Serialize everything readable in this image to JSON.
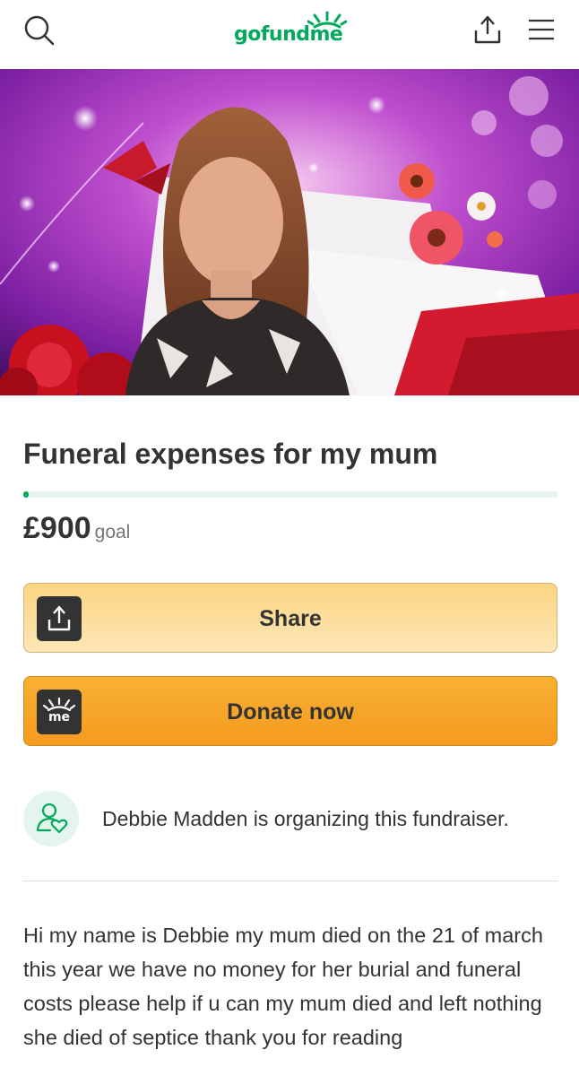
{
  "header": {
    "logo_text": "gofundme",
    "icons": [
      "search-icon",
      "share-icon",
      "menu-icon"
    ]
  },
  "campaign": {
    "title": "Funeral expenses for my mum",
    "progress_fraction": 0.01,
    "goal_amount": "£900",
    "goal_label": "goal"
  },
  "actions": {
    "share_label": "Share",
    "donate_label": "Donate now",
    "donate_icon_text": "me"
  },
  "organizer": {
    "text": "Debbie Madden is organizing this fundraiser."
  },
  "story": {
    "text": "Hi my name is Debbie my mum died on the 21 of march this year we have no money for her burial and funeral costs please help if u can my mum died and left nothing she died of septice thank you for reading"
  },
  "colors": {
    "brand_green": "#02a95c",
    "share_button": "#fcdc9c",
    "donate_button": "#f6a52a",
    "text": "#333333"
  }
}
